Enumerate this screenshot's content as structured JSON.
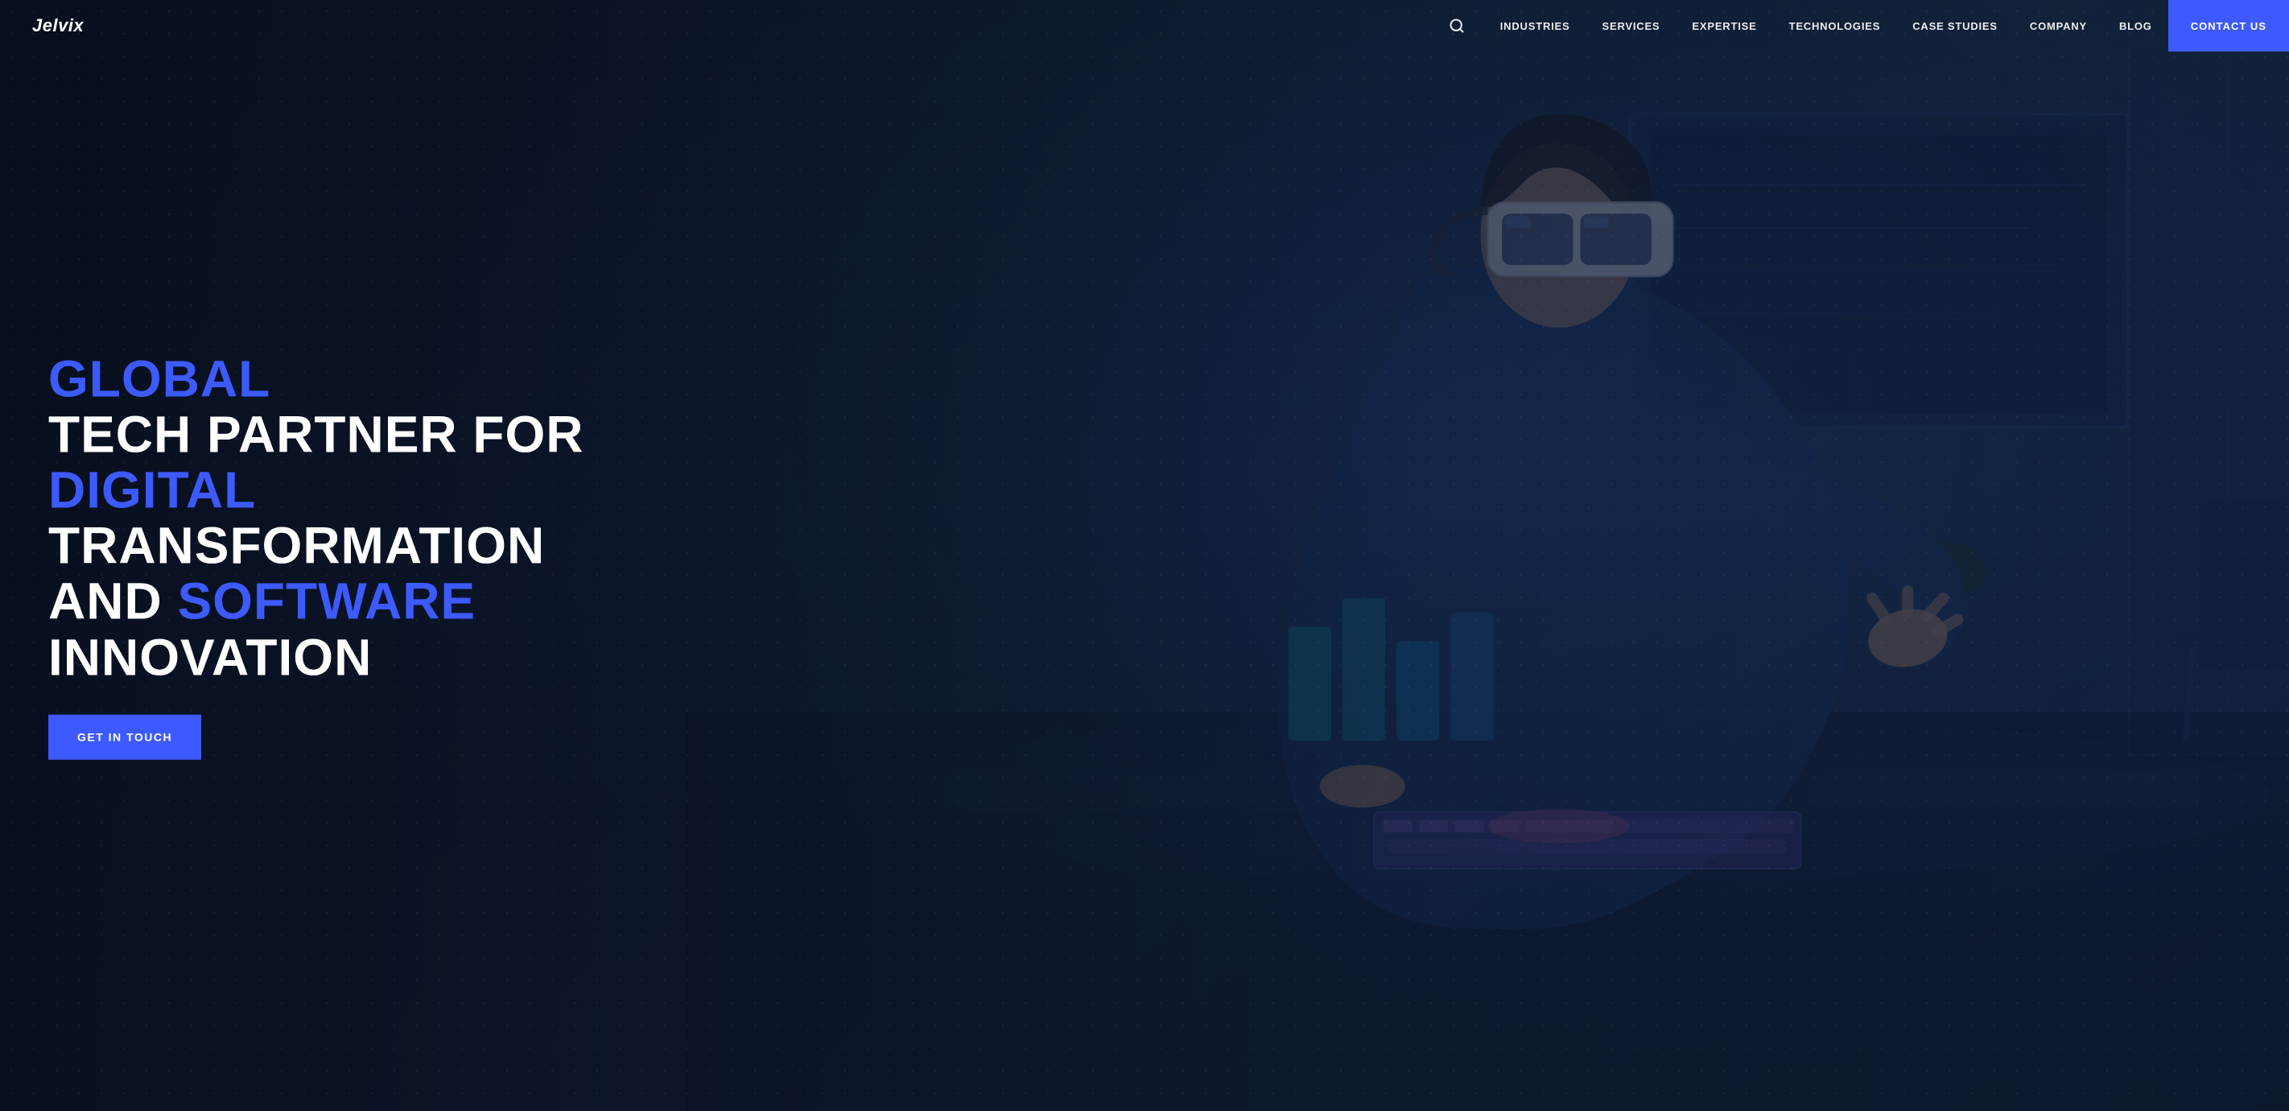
{
  "logo": {
    "text": "Jelvix"
  },
  "navbar": {
    "search_icon": "🔍",
    "items": [
      {
        "label": "INDUSTRIES",
        "id": "industries"
      },
      {
        "label": "SERVICES",
        "id": "services"
      },
      {
        "label": "EXPERTISE",
        "id": "expertise"
      },
      {
        "label": "TECHNOLOGIES",
        "id": "technologies"
      },
      {
        "label": "CASE STUDIES",
        "id": "case-studies"
      },
      {
        "label": "COMPANY",
        "id": "company"
      },
      {
        "label": "BLOG",
        "id": "blog"
      }
    ],
    "contact_label": "CONTACT US"
  },
  "hero": {
    "title_line1_blue": "GLOBAL",
    "title_line2_white": "TECH PARTNER FOR",
    "title_line3_blue": "DIGITAL",
    "title_line3_white": " TRANSFORMATION",
    "title_line4_white": "AND ",
    "title_line4_blue": "SOFTWARE",
    "title_line4_white2": " INNOVATION",
    "cta_label": "GET IN TOUCH"
  },
  "colors": {
    "accent": "#3d5afe",
    "white": "#ffffff",
    "dark_bg": "#0d1a2e",
    "nav_bg": "transparent",
    "contact_bg": "#3d5afe"
  }
}
